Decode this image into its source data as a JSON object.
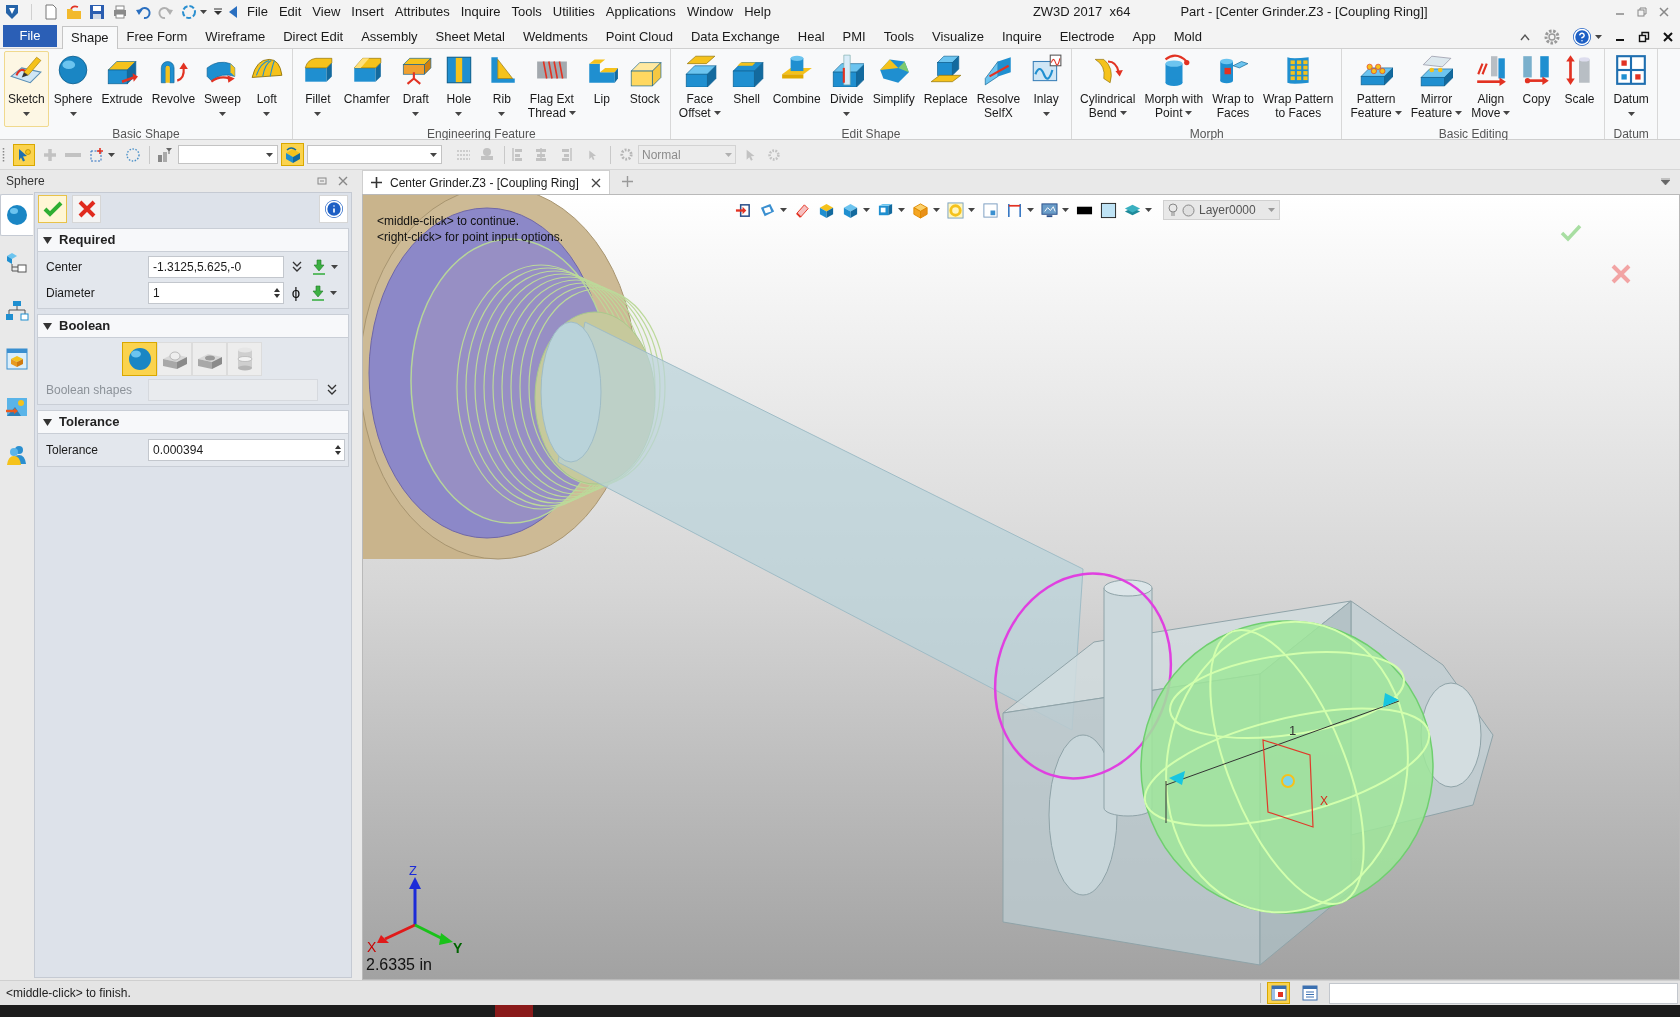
{
  "title_bar": {
    "menu": [
      "File",
      "Edit",
      "View",
      "Insert",
      "Attributes",
      "Inquire",
      "Tools",
      "Utilities",
      "Applications",
      "Window",
      "Help"
    ],
    "app_name": "ZW3D 2017  x64",
    "document": "Part - [Center Grinder.Z3 - [Coupling Ring]]"
  },
  "ribbon": {
    "file_button": "File",
    "tabs": [
      {
        "label": "Shape",
        "selected": true
      },
      {
        "label": "Free Form",
        "selected": false
      },
      {
        "label": "Wireframe",
        "selected": false
      },
      {
        "label": "Direct Edit",
        "selected": false
      },
      {
        "label": "Assembly",
        "selected": false
      },
      {
        "label": "Sheet Metal",
        "selected": false
      },
      {
        "label": "Weldments",
        "selected": false
      },
      {
        "label": "Point Cloud",
        "selected": false
      },
      {
        "label": "Data Exchange",
        "selected": false
      },
      {
        "label": "Heal",
        "selected": false
      },
      {
        "label": "PMI",
        "selected": false
      },
      {
        "label": "Tools",
        "selected": false
      },
      {
        "label": "Visualize",
        "selected": false
      },
      {
        "label": "Inquire",
        "selected": false
      },
      {
        "label": "Electrode",
        "selected": false
      },
      {
        "label": "App",
        "selected": false
      },
      {
        "label": "Mold",
        "selected": false
      }
    ],
    "groups": [
      {
        "name": "Basic Shape",
        "buttons": [
          {
            "lines": [
              "Sketch"
            ],
            "dropdown": true,
            "highlighted": true
          },
          {
            "lines": [
              "Sphere"
            ],
            "dropdown": true,
            "highlighted": false
          },
          {
            "lines": [
              "Extrude"
            ],
            "dropdown": false,
            "highlighted": false
          },
          {
            "lines": [
              "Revolve"
            ],
            "dropdown": false,
            "highlighted": false
          },
          {
            "lines": [
              "Sweep"
            ],
            "dropdown": true,
            "highlighted": false
          },
          {
            "lines": [
              "Loft"
            ],
            "dropdown": true,
            "highlighted": false
          }
        ]
      },
      {
        "name": "Engineering Feature",
        "buttons": [
          {
            "lines": [
              "Fillet"
            ],
            "dropdown": true,
            "highlighted": false
          },
          {
            "lines": [
              "Chamfer"
            ],
            "dropdown": false,
            "highlighted": false
          },
          {
            "lines": [
              "Draft"
            ],
            "dropdown": true,
            "highlighted": false
          },
          {
            "lines": [
              "Hole"
            ],
            "dropdown": true,
            "highlighted": false
          },
          {
            "lines": [
              "Rib"
            ],
            "dropdown": true,
            "highlighted": false
          },
          {
            "lines": [
              "Flag Ext",
              "Thread"
            ],
            "dropdown": true,
            "highlighted": false
          },
          {
            "lines": [
              "Lip"
            ],
            "dropdown": false,
            "highlighted": false
          },
          {
            "lines": [
              "Stock"
            ],
            "dropdown": false,
            "highlighted": false
          }
        ]
      },
      {
        "name": "Edit Shape",
        "buttons": [
          {
            "lines": [
              "Face",
              "Offset"
            ],
            "dropdown": true,
            "highlighted": false
          },
          {
            "lines": [
              "Shell"
            ],
            "dropdown": false,
            "highlighted": false
          },
          {
            "lines": [
              "Combine"
            ],
            "dropdown": false,
            "highlighted": false
          },
          {
            "lines": [
              "Divide"
            ],
            "dropdown": true,
            "highlighted": false
          },
          {
            "lines": [
              "Simplify"
            ],
            "dropdown": false,
            "highlighted": false
          },
          {
            "lines": [
              "Replace"
            ],
            "dropdown": false,
            "highlighted": false
          },
          {
            "lines": [
              "Resolve",
              "SelfX"
            ],
            "dropdown": false,
            "highlighted": false
          },
          {
            "lines": [
              "Inlay"
            ],
            "dropdown": true,
            "highlighted": false
          }
        ]
      },
      {
        "name": "Morph",
        "buttons": [
          {
            "lines": [
              "Cylindrical",
              "Bend"
            ],
            "dropdown": true,
            "highlighted": false
          },
          {
            "lines": [
              "Morph with",
              "Point"
            ],
            "dropdown": true,
            "highlighted": false
          },
          {
            "lines": [
              "Wrap to",
              "Faces"
            ],
            "dropdown": false,
            "highlighted": false
          },
          {
            "lines": [
              "Wrap Pattern",
              "to Faces"
            ],
            "dropdown": false,
            "highlighted": false
          }
        ]
      },
      {
        "name": "Basic Editing",
        "buttons": [
          {
            "lines": [
              "Pattern",
              "Feature"
            ],
            "dropdown": true,
            "highlighted": false
          },
          {
            "lines": [
              "Mirror",
              "Feature"
            ],
            "dropdown": true,
            "highlighted": false
          },
          {
            "lines": [
              "Align",
              "Move"
            ],
            "dropdown": true,
            "highlighted": false
          },
          {
            "lines": [
              "Copy"
            ],
            "dropdown": false,
            "highlighted": false
          },
          {
            "lines": [
              "Scale"
            ],
            "dropdown": false,
            "highlighted": false
          }
        ]
      },
      {
        "name": "Datum",
        "buttons": [
          {
            "lines": [
              "Datum"
            ],
            "dropdown": true,
            "highlighted": false
          }
        ]
      }
    ]
  },
  "toolbar": {
    "pick_on": true,
    "entity_filter_on": true,
    "display_mode": "Normal",
    "display_mode_disabled": true
  },
  "panel": {
    "title": "Sphere",
    "side_tabs": [
      {
        "selected": true
      },
      {
        "selected": false
      },
      {
        "selected": false
      },
      {
        "selected": false
      },
      {
        "selected": false
      },
      {
        "selected": false
      }
    ],
    "sections": [
      {
        "title": "Required",
        "expanded": true,
        "rows": [
          {
            "kind": "point",
            "label": "Center",
            "value": "-1.3125,5.625,-0"
          },
          {
            "kind": "length",
            "label": "Diameter",
            "value": "1",
            "symbol": "ϕ"
          }
        ]
      },
      {
        "title": "Boolean",
        "expanded": true,
        "rows": [
          {
            "kind": "choices",
            "options": [
              {
                "selected": true
              },
              {
                "selected": false
              },
              {
                "selected": false
              },
              {
                "selected": false
              }
            ]
          },
          {
            "kind": "list",
            "label": "Boolean shapes",
            "disabled": true
          }
        ]
      },
      {
        "title": "Tolerance",
        "expanded": true,
        "rows": [
          {
            "kind": "number",
            "label": "Tolerance",
            "value": "0.000394"
          }
        ]
      }
    ]
  },
  "viewport": {
    "tab": {
      "label": "Center Grinder.Z3 - [Coupling Ring]",
      "selected": true
    },
    "layer": "Layer0000",
    "prompts": [
      "<middle-click> to continue.",
      "<right-click> for point input options."
    ],
    "sketch_labels": [
      "1",
      "X"
    ],
    "triad": {
      "x": "X",
      "y": "Y",
      "z": "Z"
    },
    "scale": "2.6335 in"
  },
  "status_bar": {
    "message": "<middle-click> to finish.",
    "view_buttons": [
      {
        "selected": true
      },
      {
        "selected": false
      }
    ]
  }
}
